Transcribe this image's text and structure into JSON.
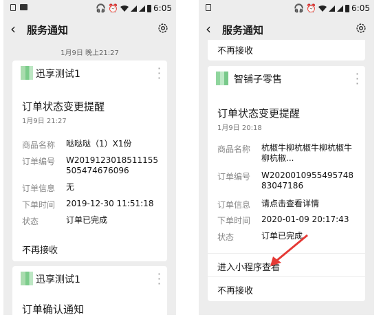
{
  "left": {
    "status_time": "6:05",
    "nav_title": "服务通知",
    "timestamp": "1月9日 晚上21:27",
    "card1": {
      "sender": "迅享测试1",
      "title": "订单状态变更提醒",
      "date": "1月9日 21:27",
      "rows": [
        {
          "label": "商品名称",
          "value": "哒哒哒（1）X1份"
        },
        {
          "label": "订单编号",
          "value": "W2019123018511155505474676096"
        },
        {
          "label": "订单信息",
          "value": "无"
        },
        {
          "label": "下单时间",
          "value": "2019-12-30 11:51:18"
        },
        {
          "label": "状态",
          "value": "订单已完成"
        }
      ],
      "footer": "不再接收"
    },
    "card2": {
      "sender": "迅享测试1",
      "title": "订单确认通知"
    }
  },
  "right": {
    "status_time": "6:05",
    "nav_title": "服务通知",
    "top_footer": "不再接收",
    "card": {
      "sender": "智铺子零售",
      "title": "订单状态变更提醒",
      "date": "1月9日 20:18",
      "rows": [
        {
          "label": "商品名称",
          "value": "杭椒牛柳杭椒牛柳杭椒牛柳杭椒..."
        },
        {
          "label": "订单编号",
          "value": "W2020010955495748 83047186"
        },
        {
          "label": "订单信息",
          "value": "请点击查看详情"
        },
        {
          "label": "下单时间",
          "value": "2020-01-09 20:17:43"
        },
        {
          "label": "状态",
          "value": "订单已完成"
        }
      ],
      "mini_program": "进入小程序查看",
      "footer": "不再接收"
    }
  },
  "colors": {
    "arrow": "#e53935",
    "background": "#ededed"
  }
}
